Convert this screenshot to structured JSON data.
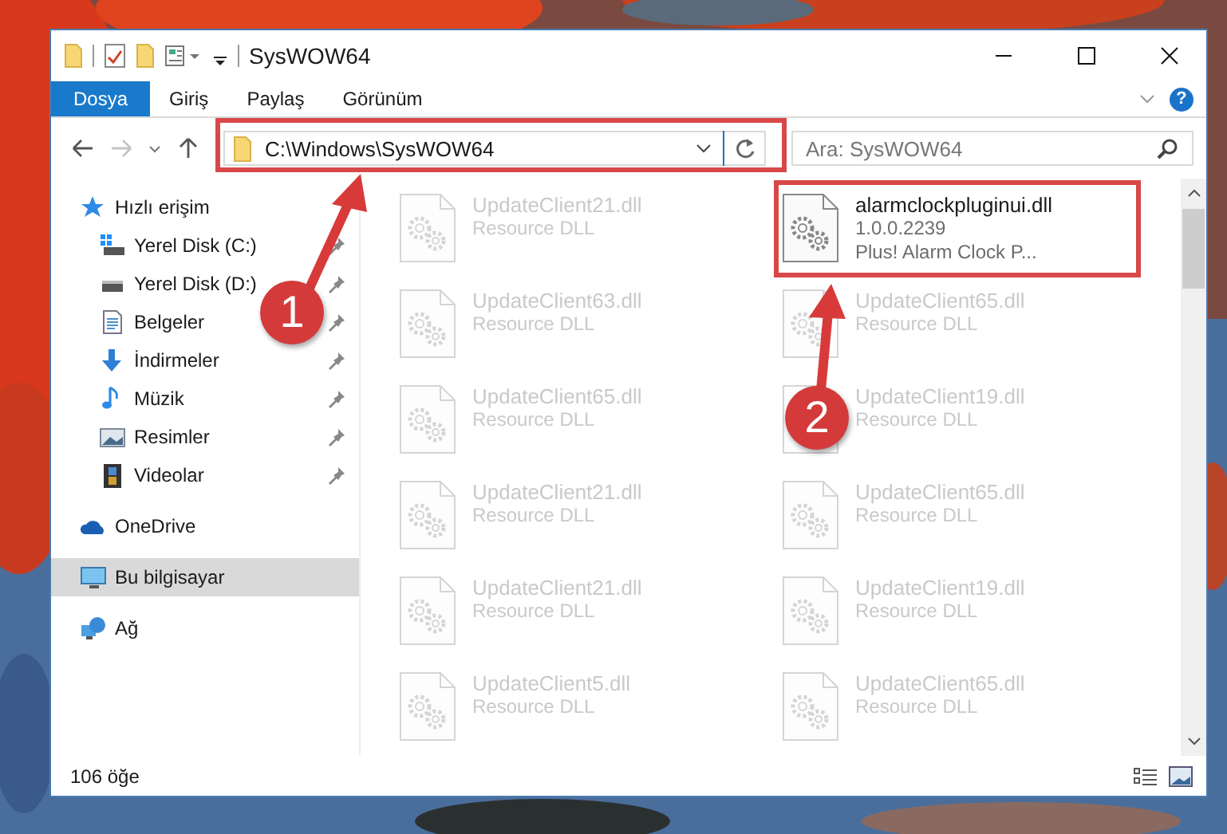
{
  "window": {
    "title": "SysWOW64"
  },
  "ribbon": {
    "tabs": [
      {
        "label": "Dosya",
        "selected": true
      },
      {
        "label": "Giriş",
        "selected": false
      },
      {
        "label": "Paylaş",
        "selected": false
      },
      {
        "label": "Görünüm",
        "selected": false
      }
    ],
    "help": "?"
  },
  "address_bar": {
    "path": "C:\\Windows\\SysWOW64",
    "forward_disabled": true
  },
  "search": {
    "placeholder": "Ara: SysWOW64"
  },
  "sidebar": {
    "items": [
      {
        "label": "Hızlı erişim",
        "kind": "quick",
        "selected": false,
        "children": [
          {
            "label": "Yerel Disk (C:)",
            "kind": "system-drive",
            "selected": false,
            "pinned": true
          },
          {
            "label": "Yerel Disk (D:)",
            "kind": "drive",
            "selected": false,
            "pinned": true
          },
          {
            "label": "Belgeler",
            "kind": "documents",
            "selected": false,
            "pinned": true
          },
          {
            "label": "İndirmeler",
            "kind": "downloads",
            "selected": false,
            "pinned": true
          },
          {
            "label": "Müzik",
            "kind": "music",
            "selected": false,
            "pinned": true
          },
          {
            "label": "Resimler",
            "kind": "pictures",
            "selected": false,
            "pinned": true
          },
          {
            "label": "Videolar",
            "kind": "videos",
            "selected": false,
            "pinned": true
          }
        ]
      },
      {
        "label": "OneDrive",
        "kind": "cloud",
        "selected": false
      },
      {
        "label": "Bu bilgisayar",
        "kind": "computer",
        "selected": true
      },
      {
        "label": "Ağ",
        "kind": "network",
        "selected": false
      }
    ]
  },
  "files": [
    {
      "name": "UpdateClient21.dll",
      "details": [
        "Resource DLL"
      ],
      "faded": true
    },
    {
      "name": "alarmclockpluginui.dll",
      "details": [
        "1.0.0.2239",
        "Plus! Alarm Clock P..."
      ],
      "faded": false
    },
    {
      "name": "UpdateClient63.dll",
      "details": [
        "Resource DLL"
      ],
      "faded": true
    },
    {
      "name": "UpdateClient65.dll",
      "details": [
        "Resource DLL"
      ],
      "faded": true
    },
    {
      "name": "UpdateClient65.dll",
      "details": [
        "Resource DLL"
      ],
      "faded": true
    },
    {
      "name": "UpdateClient19.dll",
      "details": [
        "Resource DLL"
      ],
      "faded": true
    },
    {
      "name": "UpdateClient21.dll",
      "details": [
        "Resource DLL"
      ],
      "faded": true
    },
    {
      "name": "UpdateClient65.dll",
      "details": [
        "Resource DLL"
      ],
      "faded": true
    },
    {
      "name": "UpdateClient21.dll",
      "details": [
        "Resource DLL"
      ],
      "faded": true
    },
    {
      "name": "UpdateClient19.dll",
      "details": [
        "Resource DLL"
      ],
      "faded": true
    },
    {
      "name": "UpdateClient5.dll",
      "details": [
        "Resource DLL"
      ],
      "faded": true
    },
    {
      "name": "UpdateClient65.dll",
      "details": [
        "Resource DLL"
      ],
      "faded": true
    }
  ],
  "status_bar": {
    "item_count": "106 öğe"
  },
  "annotations": [
    {
      "label": "1"
    },
    {
      "label": "2"
    }
  ]
}
